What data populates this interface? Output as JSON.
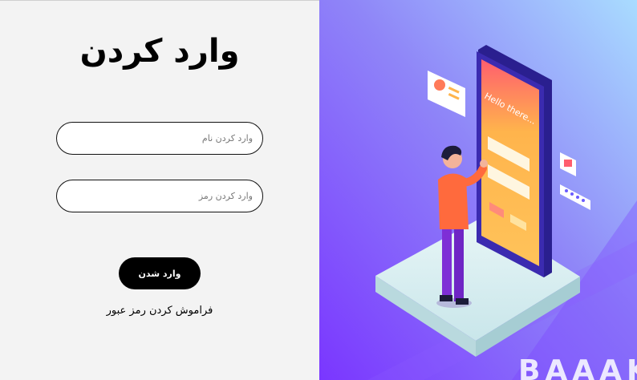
{
  "login": {
    "title": "وارد کردن",
    "username_placeholder": "وارد کردن نام",
    "password_placeholder": "وارد کردن رمز",
    "submit_label": "وارد شدن",
    "forgot_link": "فراموش کردن رمز عبور"
  },
  "illustration": {
    "phone_text": "Hello there...",
    "watermark": "BAAAK"
  },
  "colors": {
    "left_bg": "#f3f3f3",
    "button_bg": "#000000",
    "gradient_top": "#a6d8ff",
    "gradient_bottom": "#7c3cff",
    "phone_screen": "#ffb54a",
    "phone_frame": "#3b2bb0"
  }
}
